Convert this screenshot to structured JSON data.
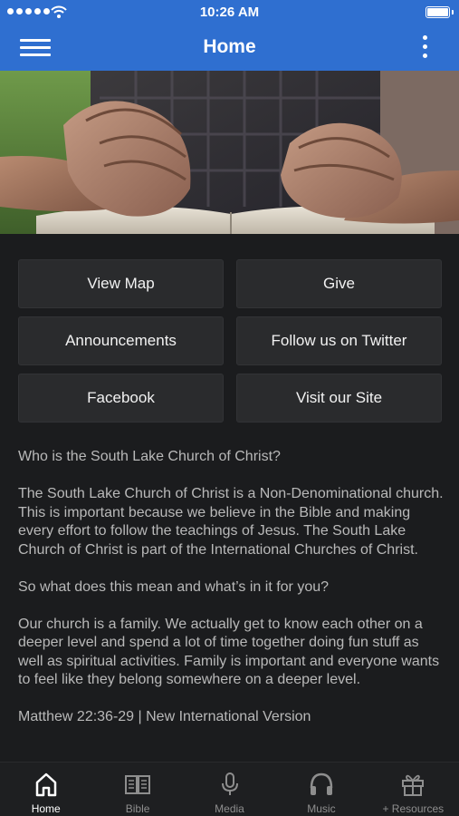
{
  "status_bar": {
    "time": "10:26 AM"
  },
  "app_bar": {
    "title": "Home"
  },
  "buttons": [
    {
      "label": "View Map"
    },
    {
      "label": "Give"
    },
    {
      "label": "Announcements"
    },
    {
      "label": "Follow us on Twitter"
    },
    {
      "label": "Facebook"
    },
    {
      "label": "Visit our Site"
    }
  ],
  "content": {
    "paragraphs": [
      "Who is the South Lake Church of Christ?",
      "The South Lake Church of Christ is a Non-Denominational church.  This is important because we believe in the Bible and making every effort to follow the teachings of Jesus. The South Lake Church of Christ is part of the International Churches of Christ.",
      "So what does this mean and what’s in it for you?",
      "Our church is a family.  We actually get to know each other on a deeper level and spend a lot of time together doing fun stuff as well as spiritual activities.  Family is important and everyone wants to feel like they belong somewhere on a deeper level.",
      "Matthew 22:36-29 | New International Version"
    ]
  },
  "tab_bar": {
    "active": "home",
    "tabs": [
      {
        "label": "Home",
        "icon": "home-icon"
      },
      {
        "label": "Bible",
        "icon": "bible-icon"
      },
      {
        "label": "Media",
        "icon": "microphone-icon"
      },
      {
        "label": "Music",
        "icon": "headphones-icon"
      },
      {
        "label": "+ Resources",
        "icon": "gift-icon"
      }
    ]
  },
  "colors": {
    "accent": "#2f6fd0",
    "background": "#1b1c1e",
    "button": "#2a2b2d",
    "text": "#b9b9b9"
  }
}
